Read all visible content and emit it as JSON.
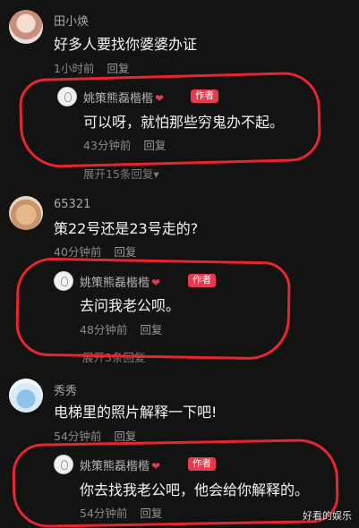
{
  "comments": [
    {
      "user": "田小焕",
      "text": "好多人要找你婆婆办证",
      "time": "1小时前",
      "reply_label": "回复",
      "author_reply": {
        "user": "姚策熊磊楷楷",
        "badge": "作者",
        "text": "可以呀，就怕那些穷鬼办不起。",
        "time": "43分钟前",
        "reply_label": "回复"
      },
      "expand_label": "展开15条回复▾"
    },
    {
      "user": "65321",
      "text": "策22号还是23号走的?",
      "time": "40分钟前",
      "reply_label": "回复",
      "author_reply": {
        "user": "姚策熊磊楷楷",
        "badge": "作者",
        "text": "去问我老公呗。",
        "time": "48分钟前",
        "reply_label": "回复"
      },
      "expand_label": "展开3条回复"
    },
    {
      "user": "秀秀",
      "text": "电梯里的照片解释一下吧!",
      "time": "54分钟前",
      "reply_label": "回复",
      "author_reply": {
        "user": "姚策熊磊楷楷",
        "badge": "作者",
        "text": "你去找我老公吧，他会给你解释的。",
        "time": "54分钟前",
        "reply_label": "回复"
      }
    }
  ],
  "heart_icon": "❤",
  "watermark": "好看的娱乐",
  "colors": {
    "background": "#131313",
    "badge": "#e83a4e",
    "annotation": "#e8262f"
  }
}
